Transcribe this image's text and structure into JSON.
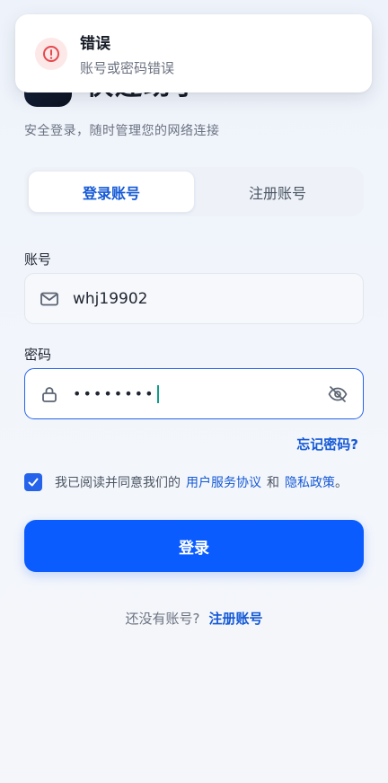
{
  "app": {
    "title": "快连助手",
    "subtitle": "安全登录，随时管理您的网络连接"
  },
  "toast": {
    "title": "错误",
    "message": "账号或密码错误",
    "icon": "error-circle-icon",
    "accent_color": "#e5484d"
  },
  "tabs": [
    {
      "label": "登录账号",
      "active": true
    },
    {
      "label": "注册账号",
      "active": false
    }
  ],
  "account": {
    "label": "账号",
    "value": "whj19902",
    "icon": "mail-icon"
  },
  "password": {
    "label": "密码",
    "masked_value": "••••••••",
    "icon": "lock-icon",
    "toggle_icon": "eye-off-icon"
  },
  "forgot_password": "忘记密码?",
  "agreement": {
    "checked": true,
    "prefix": "我已阅读并同意我们的",
    "terms": "用户服务协议",
    "and": "和",
    "privacy": "隐私政策",
    "suffix": "。"
  },
  "login_button": "登录",
  "footer": {
    "prompt": "还没有账号?",
    "register_link": "注册账号"
  },
  "colors": {
    "primary": "#0a5cff",
    "link": "#1559d6",
    "error": "#e5484d"
  }
}
